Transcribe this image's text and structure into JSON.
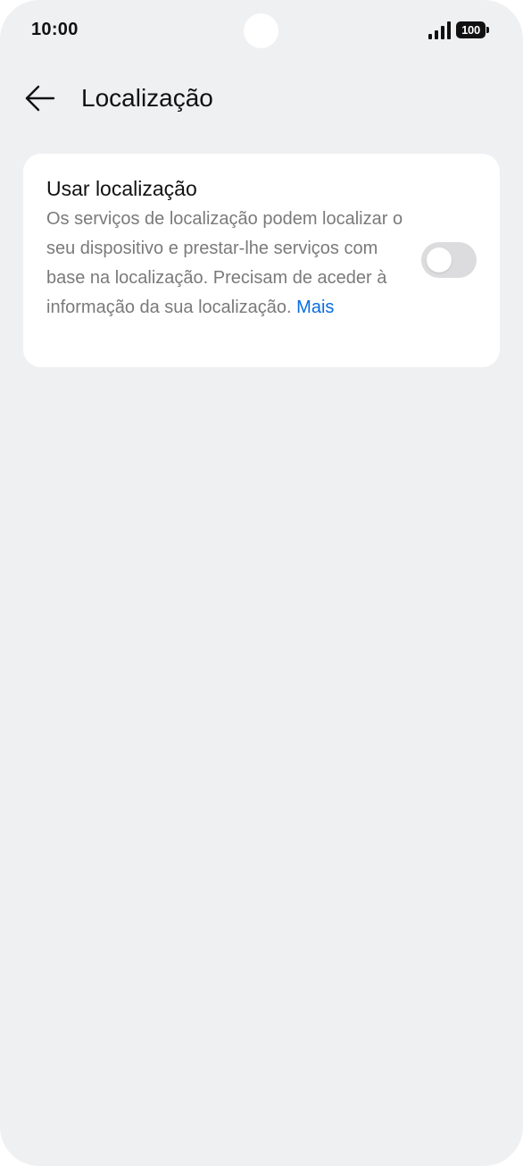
{
  "status_bar": {
    "time": "10:00",
    "battery_level": "100",
    "signal_icon": "signal-bars-icon",
    "battery_icon": "battery-icon"
  },
  "header": {
    "back_icon": "arrow-left-icon",
    "title": "Localização"
  },
  "location_setting": {
    "title": "Usar localização",
    "description": "Os serviços de localização podem localizar o seu dispositivo e prestar-lhe serviços com base na localização. Precisam de aceder à informação da sua localização.",
    "more_link": "Mais",
    "toggle_on": false
  },
  "colors": {
    "background": "#eff0f2",
    "card": "#ffffff",
    "link": "#0a6ce0",
    "toggle_off": "#dcdcde",
    "secondary_text": "#7a7a7a"
  }
}
